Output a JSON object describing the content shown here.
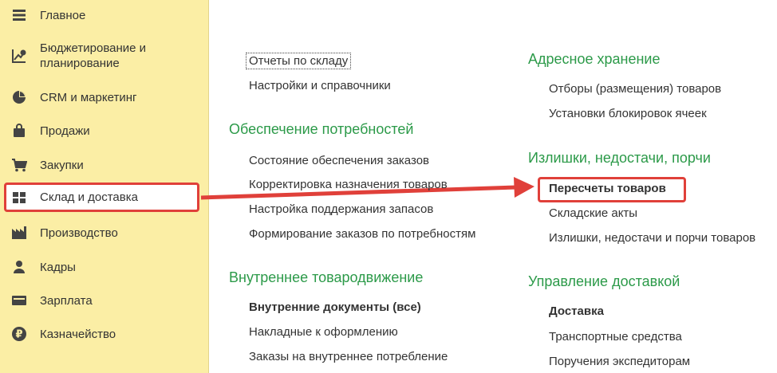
{
  "sidebar": {
    "items": [
      {
        "label": "Главное",
        "icon": "hamburger-icon"
      },
      {
        "label": "Бюджетирование и\nпланирование",
        "icon": "budget-chart-icon"
      },
      {
        "label": "CRM и маркетинг",
        "icon": "pie-chart-icon"
      },
      {
        "label": "Продажи",
        "icon": "shopping-bag-icon"
      },
      {
        "label": "Закупки",
        "icon": "cart-icon"
      },
      {
        "label": "Склад и доставка",
        "icon": "warehouse-grid-icon"
      },
      {
        "label": "Производство",
        "icon": "factory-icon"
      },
      {
        "label": "Кадры",
        "icon": "person-icon"
      },
      {
        "label": "Зарплата",
        "icon": "wallet-icon"
      },
      {
        "label": "Казначейство",
        "icon": "ruble-coin-icon"
      }
    ]
  },
  "col1": {
    "top_links": [
      "Отчеты по складу",
      "Настройки и справочники"
    ],
    "sections": [
      {
        "title": "Обеспечение потребностей",
        "links": [
          "Состояние обеспечения заказов",
          "Корректировка назначения товаров",
          "Настройка поддержания запасов",
          "Формирование заказов по потребностям"
        ]
      },
      {
        "title": "Внутреннее товародвижение",
        "links": [
          "Внутренние документы (все)",
          "Накладные к оформлению",
          "Заказы на внутреннее потребление"
        ]
      }
    ]
  },
  "col2": {
    "sections": [
      {
        "title": "Адресное хранение",
        "links": [
          "Отборы (размещения) товаров",
          "Установки блокировок ячеек"
        ]
      },
      {
        "title": "Излишки, недостачи, порчи",
        "links": [
          "Пересчеты товаров",
          "Складские акты",
          "Излишки, недостачи и порчи товаров"
        ]
      },
      {
        "title": "Управление доставкой",
        "links": [
          "Доставка",
          "Транспортные средства",
          "Поручения экспедиторам"
        ]
      }
    ]
  },
  "colors": {
    "sidebar_bg": "#fbeea5",
    "section_title": "#2c9a49",
    "highlight": "#e0403a"
  }
}
